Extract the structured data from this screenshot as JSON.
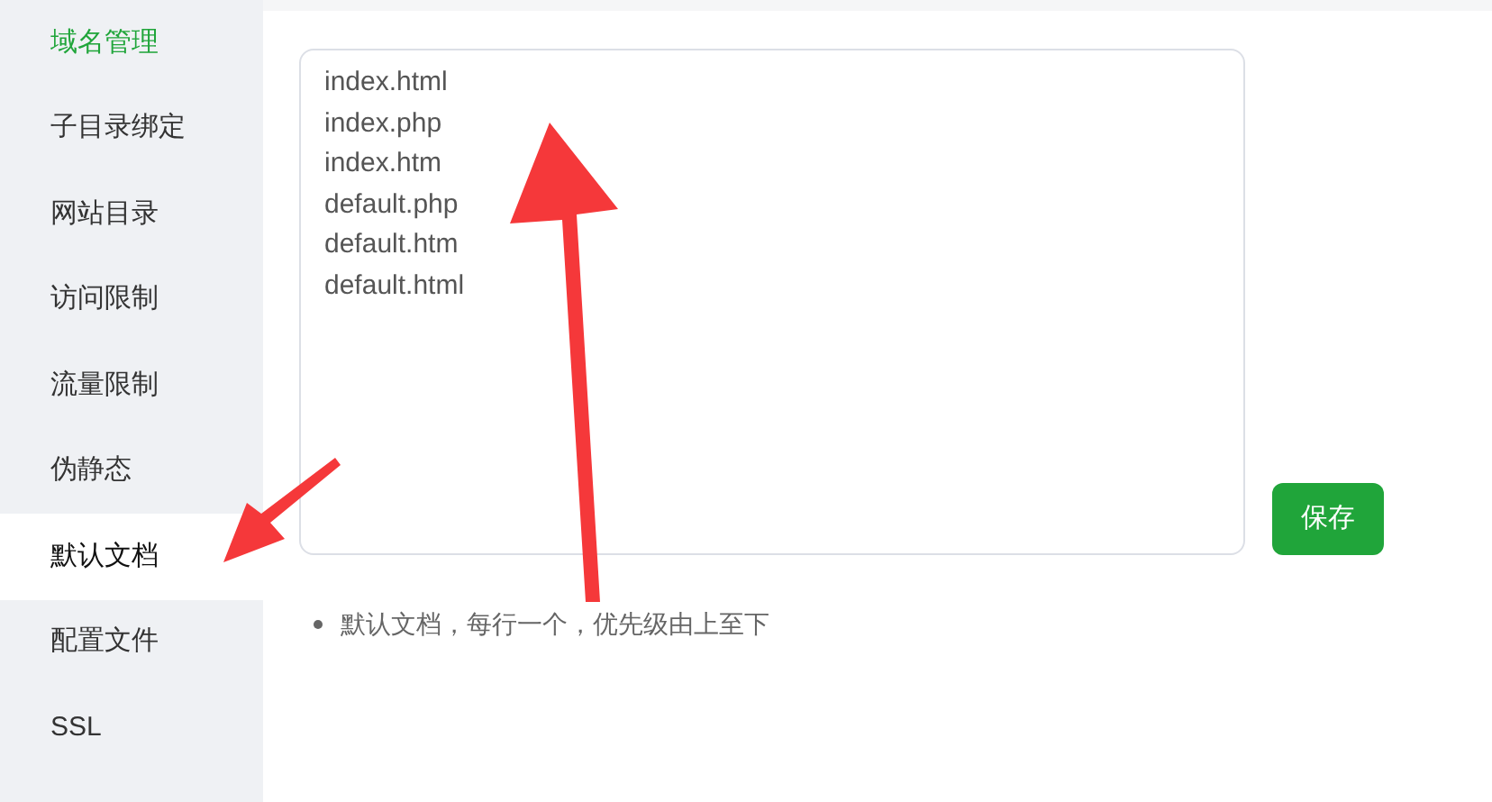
{
  "sidebar": {
    "items": [
      {
        "label": "域名管理",
        "selected": false,
        "hover": true
      },
      {
        "label": "子目录绑定",
        "selected": false,
        "hover": false
      },
      {
        "label": "网站目录",
        "selected": false,
        "hover": false
      },
      {
        "label": "访问限制",
        "selected": false,
        "hover": false
      },
      {
        "label": "流量限制",
        "selected": false,
        "hover": false
      },
      {
        "label": "伪静态",
        "selected": false,
        "hover": false
      },
      {
        "label": "默认文档",
        "selected": true,
        "hover": false
      },
      {
        "label": "配置文件",
        "selected": false,
        "hover": false
      },
      {
        "label": "SSL",
        "selected": false,
        "hover": false
      }
    ]
  },
  "editor": {
    "value": "index.html\nindex.php\nindex.htm\ndefault.php\ndefault.htm\ndefault.html"
  },
  "save_button": "保存",
  "notes": [
    "默认文档，每行一个，优先级由上至下"
  ]
}
